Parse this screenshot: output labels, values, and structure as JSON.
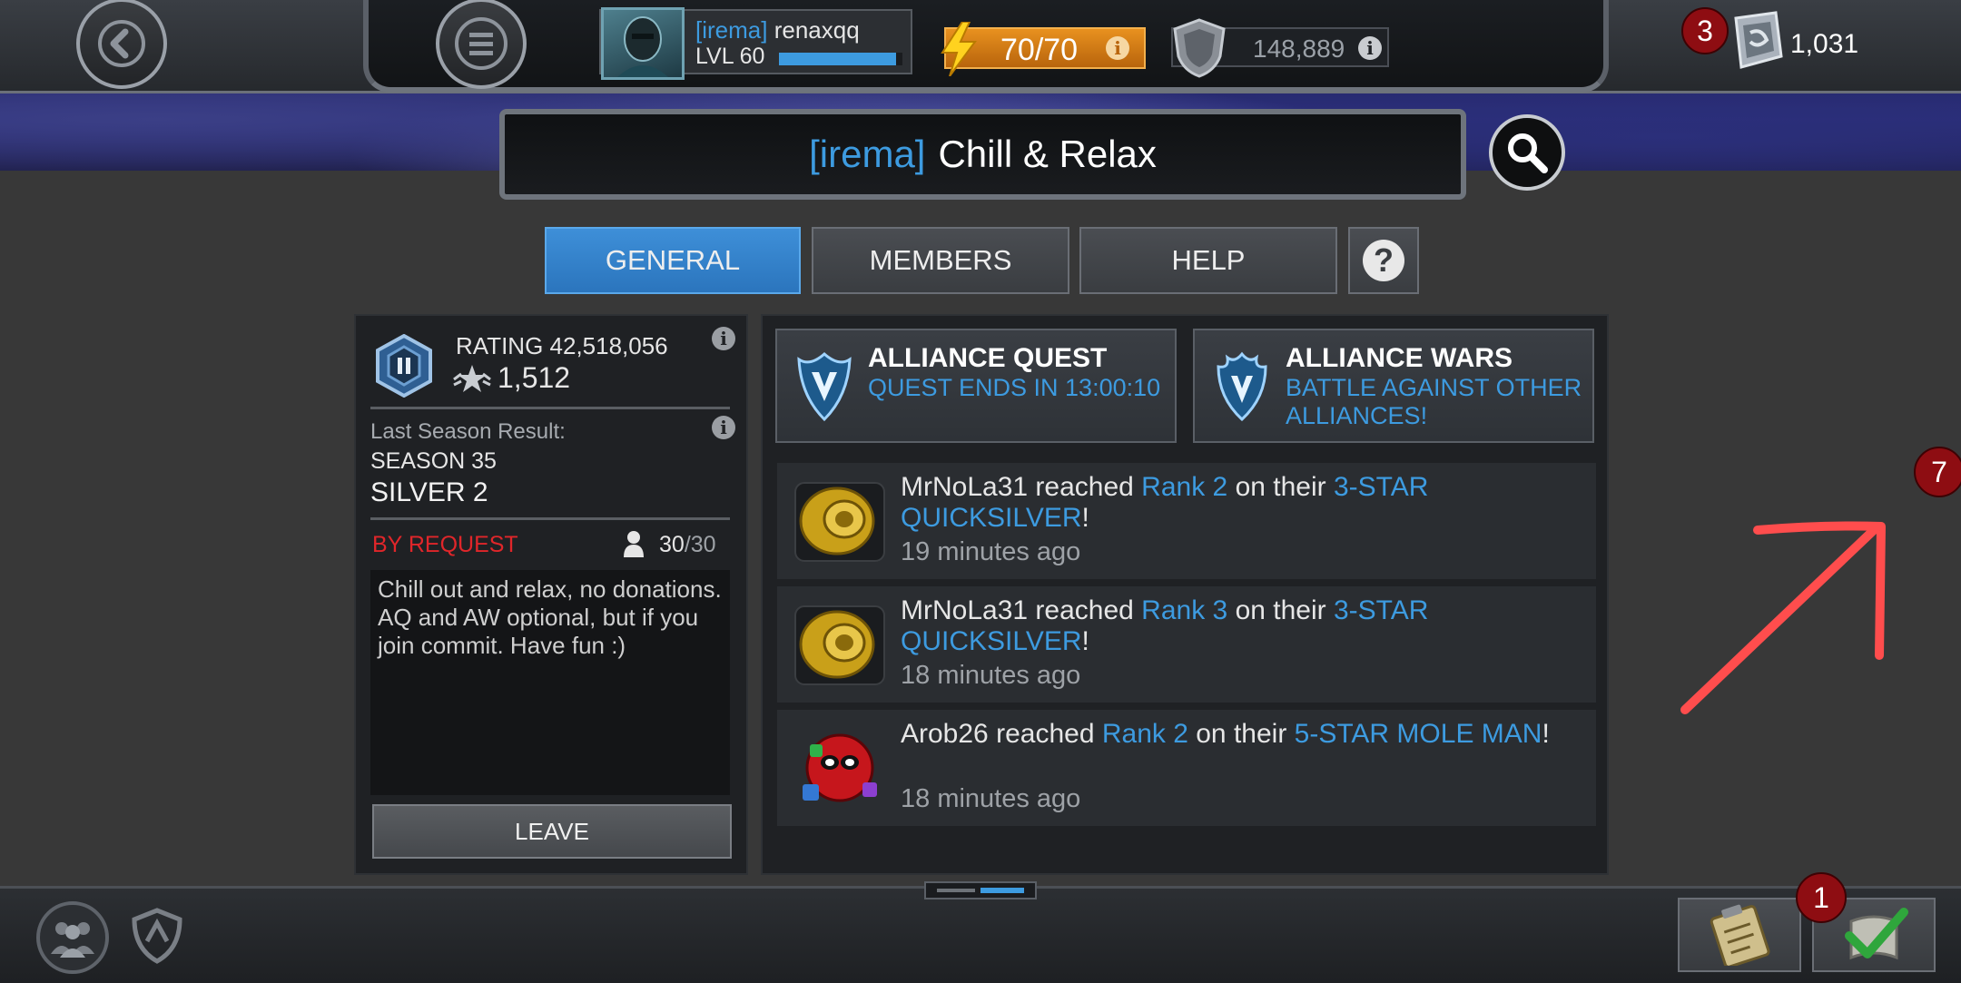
{
  "header": {
    "back_icon": "chevron-left-icon",
    "menu_icon": "hamburger-menu-icon",
    "profile": {
      "alliance_tag": "[irema]",
      "username": "renaxqq",
      "level": "LVL 60",
      "xp_fraction": 0.95
    },
    "energy": {
      "value": "70/70",
      "info": "i"
    },
    "gold": {
      "value": "148,889",
      "info": "i"
    },
    "units": {
      "notification_count": "3",
      "value": "1,031"
    }
  },
  "alliance": {
    "tag": "[irema]",
    "name": "Chill & Relax"
  },
  "tabs": [
    {
      "label": "GENERAL",
      "active": true
    },
    {
      "label": "MEMBERS",
      "active": false
    },
    {
      "label": "HELP",
      "active": false
    },
    {
      "label": "?",
      "active": false
    }
  ],
  "info_panel": {
    "rating": "RATING 42,518,056",
    "prestige": "1,512",
    "last_season_label": "Last Season Result:",
    "season": "SEASON 35",
    "tier": "SILVER 2",
    "join_type": "BY REQUEST",
    "members_count": "30",
    "members_max": "/30",
    "description": "Chill out and relax, no donations. AQ and AW optional, but if you join commit. Have fun :)",
    "leave_label": "LEAVE"
  },
  "modes": [
    {
      "title": "ALLIANCE QUEST",
      "subtitle": "QUEST ENDS IN 13:00:10"
    },
    {
      "title": "ALLIANCE WARS",
      "subtitle": "BATTLE AGAINST OTHER ALLIANCES!"
    }
  ],
  "feed": [
    {
      "user": "MrNoLa31",
      "verb": " reached ",
      "rank": "Rank 2",
      "mid": " on their ",
      "champion": "3-STAR QUICKSILVER",
      "end": "!",
      "time": "19 minutes ago",
      "icon": "gold-ring-icon"
    },
    {
      "user": "MrNoLa31",
      "verb": " reached ",
      "rank": "Rank 3",
      "mid": " on their ",
      "champion": "3-STAR QUICKSILVER",
      "end": "!",
      "time": "18 minutes ago",
      "icon": "gold-ring-icon"
    },
    {
      "user": "Arob26",
      "verb": " reached ",
      "rank": "Rank 2",
      "mid": " on their ",
      "champion": "5-STAR MOLE MAN",
      "end": "!",
      "time": "18 minutes ago",
      "icon": "deadpool-avatar-icon"
    }
  ],
  "side_badge": "7",
  "bottom": {
    "quest_badge": "1"
  },
  "colors": {
    "accent_blue": "#3d9be0",
    "energy_orange": "#e8911f",
    "by_request_red": "#e0262a",
    "badge_red": "#8e0d12",
    "annotation_red": "#ff4d4d"
  }
}
